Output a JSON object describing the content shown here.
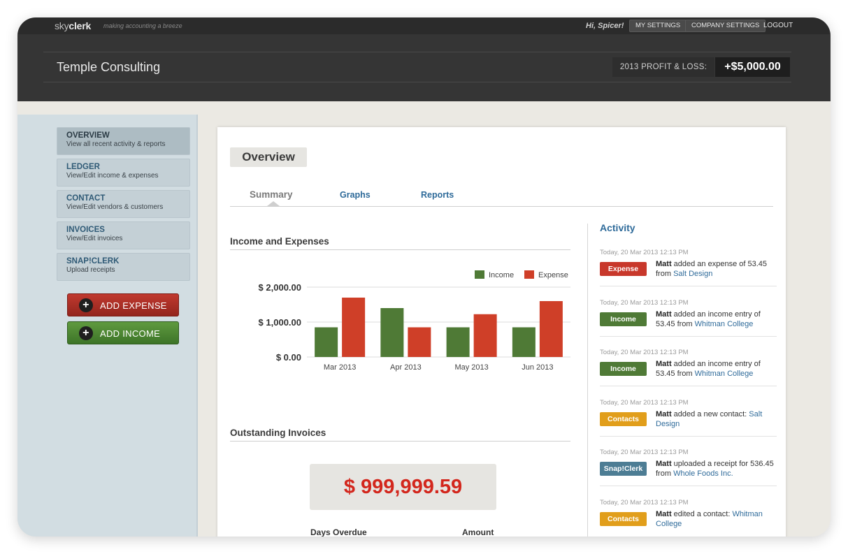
{
  "topbar": {
    "logo_light": "sky",
    "logo_bold": "clerk",
    "tagline": "making accounting a breeze",
    "greeting": "Hi, Spicer!",
    "my_settings": "MY SETTINGS",
    "company_settings": "COMPANY SETTINGS",
    "logout": "LOGOUT"
  },
  "header": {
    "company": "Temple Consulting",
    "pl_label": "2013 PROFIT & LOSS:",
    "pl_value": "+$5,000.00"
  },
  "sidebar": {
    "items": [
      {
        "title": "OVERVIEW",
        "subtitle": "View all recent activity & reports"
      },
      {
        "title": "LEDGER",
        "subtitle": "View/Edit income & expenses"
      },
      {
        "title": "CONTACT",
        "subtitle": "View/Edit vendors & customers"
      },
      {
        "title": "INVOICES",
        "subtitle": "View/Edit invoices"
      },
      {
        "title": "SNAP!CLERK",
        "subtitle": "Upload receipts"
      }
    ],
    "add_expense": "ADD EXPENSE",
    "add_income": "ADD INCOME"
  },
  "main": {
    "title": "Overview",
    "tabs": [
      "Summary",
      "Graphs",
      "Reports"
    ],
    "income_expenses_title": "Income and Expenses",
    "outstanding_title": "Outstanding Invoices",
    "outstanding_amount": "$ 999,999.59",
    "col_days": "Days Overdue",
    "col_amount": "Amount"
  },
  "chart_data": {
    "type": "bar",
    "title": "Income and Expenses",
    "categories": [
      "Mar 2013",
      "Apr 2013",
      "May 2013",
      "Jun 2013"
    ],
    "series": [
      {
        "name": "Income",
        "color": "#4f7a36",
        "values": [
          850,
          1400,
          850,
          850
        ]
      },
      {
        "name": "Expense",
        "color": "#cf3f28",
        "values": [
          1700,
          850,
          1225,
          1600
        ]
      }
    ],
    "yticks": [
      "$ 2,000.00",
      "$ 1,000.00",
      "$ 0.00"
    ],
    "ylim": [
      0,
      2000
    ],
    "legend": "top-right",
    "grid": true
  },
  "activity": {
    "title": "Activity",
    "items": [
      {
        "time": "Today, 20 Mar 2013 12:13 PM",
        "badge": "Expense",
        "color": "#c8382b",
        "user": "Matt",
        "text": " added an expense of 53.45 from ",
        "link": "Salt Design"
      },
      {
        "time": "Today, 20 Mar 2013 12:13 PM",
        "badge": "Income",
        "color": "#4f7a36",
        "user": "Matt",
        "text": " added an income entry of 53.45 from ",
        "link": "Whitman College"
      },
      {
        "time": "Today, 20 Mar 2013 12:13 PM",
        "badge": "Income",
        "color": "#4f7a36",
        "user": "Matt",
        "text": " added an income entry of 53.45 from ",
        "link": "Whitman College"
      },
      {
        "time": "Today, 20 Mar 2013 12:13 PM",
        "badge": "Contacts",
        "color": "#e19e1b",
        "user": "Matt",
        "text": " added a new contact: ",
        "link": "Salt Design"
      },
      {
        "time": "Today, 20 Mar 2013 12:13 PM",
        "badge": "Snap!Clerk",
        "color": "#4d7d94",
        "user": "Matt",
        "text": " uploaded a receipt for 536.45 from ",
        "link": "Whole Foods Inc."
      },
      {
        "time": "Today, 20 Mar 2013 12:13 PM",
        "badge": "Contacts",
        "color": "#e19e1b",
        "user": "Matt",
        "text": " edited a contact: ",
        "link": "Whitman College"
      }
    ]
  }
}
